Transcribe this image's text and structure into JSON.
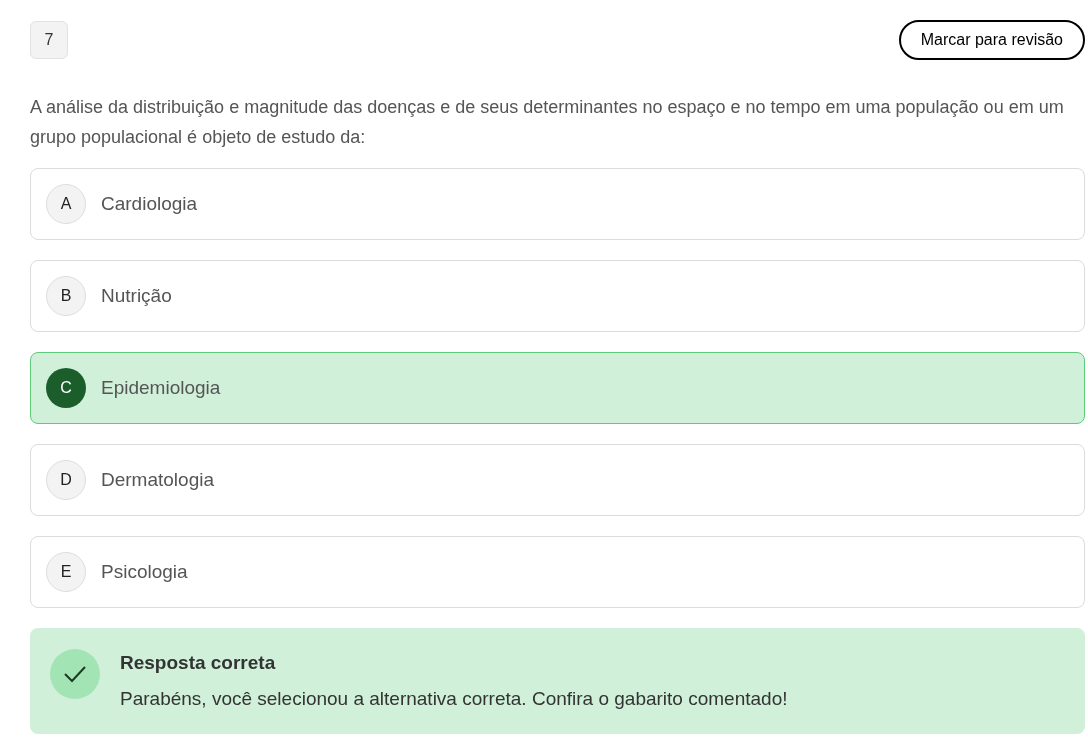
{
  "question_number": "7",
  "review_button": "Marcar para revisão",
  "question": "A análise da distribuição e magnitude das doenças e de seus determinantes no espaço e no tempo em uma população ou em um grupo populacional é objeto de estudo da:",
  "options": [
    {
      "letter": "A",
      "text": "Cardiologia",
      "selected": false
    },
    {
      "letter": "B",
      "text": "Nutrição",
      "selected": false
    },
    {
      "letter": "C",
      "text": "Epidemiologia",
      "selected": true
    },
    {
      "letter": "D",
      "text": "Dermatologia",
      "selected": false
    },
    {
      "letter": "E",
      "text": "Psicologia",
      "selected": false
    }
  ],
  "feedback": {
    "kind": "correct",
    "title": "Resposta correta",
    "message": "Parabéns, você selecionou a alternativa correta. Confira o gabarito comentado!"
  }
}
